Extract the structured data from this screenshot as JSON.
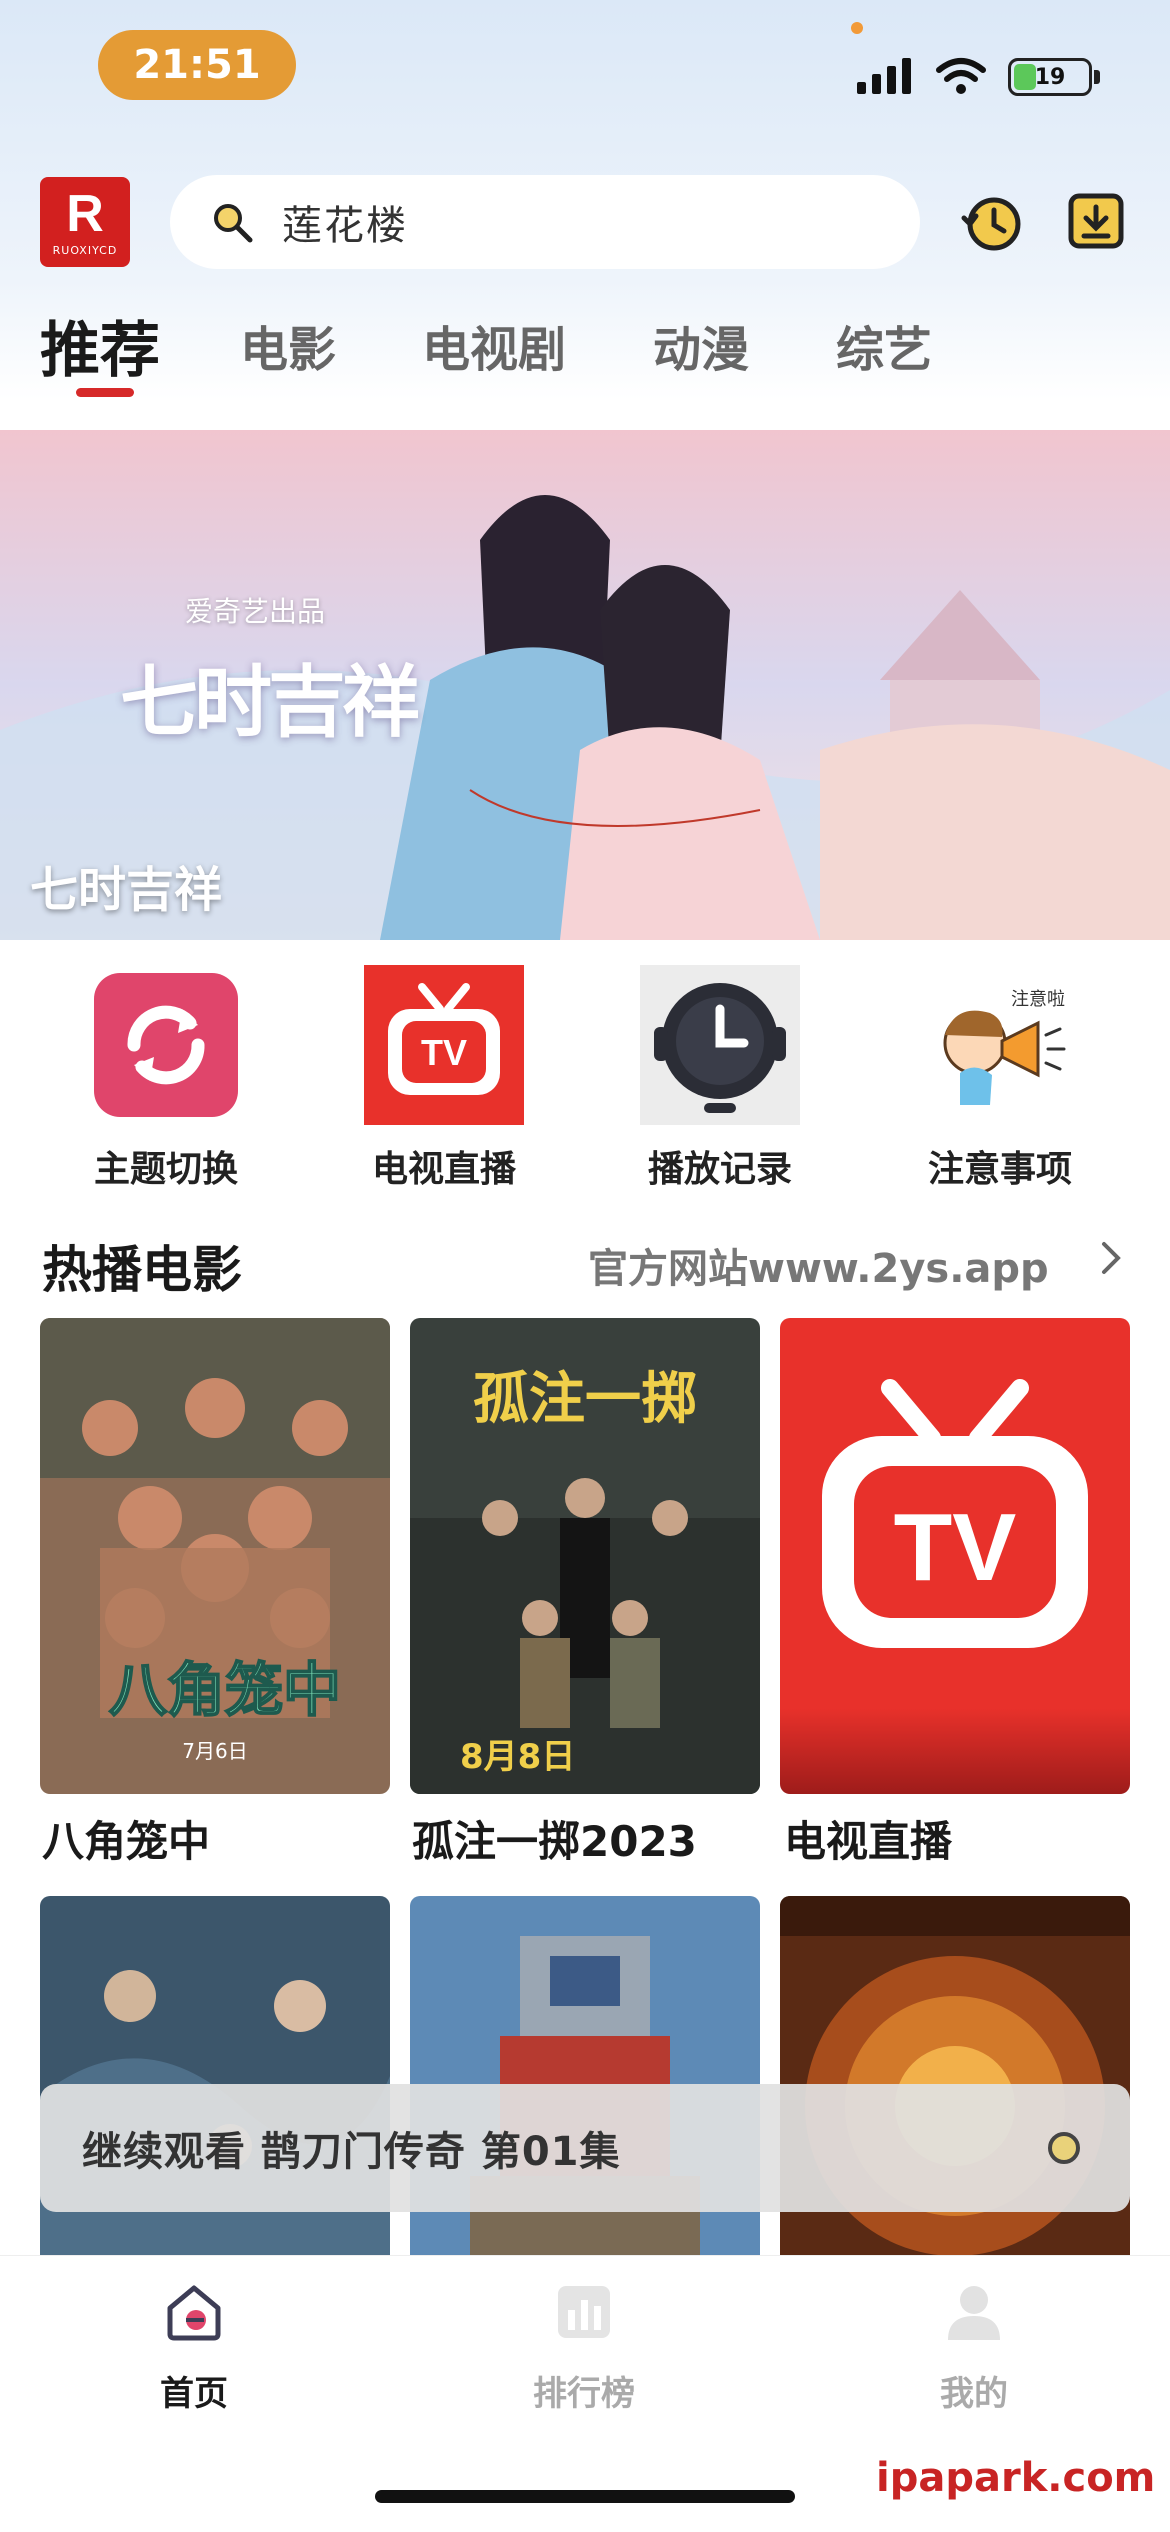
{
  "status_bar": {
    "time": "21:51",
    "battery": "19"
  },
  "header": {
    "logo_text": "RUOXIYCD",
    "search_value": "莲花楼"
  },
  "tabs": [
    {
      "label": "推荐",
      "active": true
    },
    {
      "label": "电影"
    },
    {
      "label": "电视剧"
    },
    {
      "label": "动漫"
    },
    {
      "label": "综艺"
    }
  ],
  "banner": {
    "title": "七时吉祥",
    "artwork_text": "七时吉祥",
    "artwork_subtext": "爱奇艺出品"
  },
  "quick_entries": [
    {
      "label": "主题切换",
      "icon": "theme-switch-icon"
    },
    {
      "label": "电视直播",
      "icon": "tv-icon"
    },
    {
      "label": "播放记录",
      "icon": "history-clock-icon"
    },
    {
      "label": "注意事项",
      "icon": "notice-icon"
    }
  ],
  "section": {
    "title": "热播电影",
    "link": "官方网站www.2ys.app"
  },
  "posters_row1": [
    {
      "title": "八角笼中",
      "poster_text": "八角笼中",
      "poster_date": "7月6日"
    },
    {
      "title": "孤注一掷2023",
      "poster_text": "孤注一掷",
      "poster_date": "8月8日"
    },
    {
      "title": "电视直播",
      "poster_text": "TV"
    }
  ],
  "continue_watching": {
    "text": "继续观看 鹊刀门传奇 第01集"
  },
  "bottom_nav": [
    {
      "label": "首页",
      "icon": "home-icon",
      "active": true
    },
    {
      "label": "排行榜",
      "icon": "ranking-icon"
    },
    {
      "label": "我的",
      "icon": "profile-icon"
    }
  ],
  "watermark": "ipapark.com",
  "colors": {
    "accent": "#d62929",
    "time_pill": "#e49b35"
  }
}
